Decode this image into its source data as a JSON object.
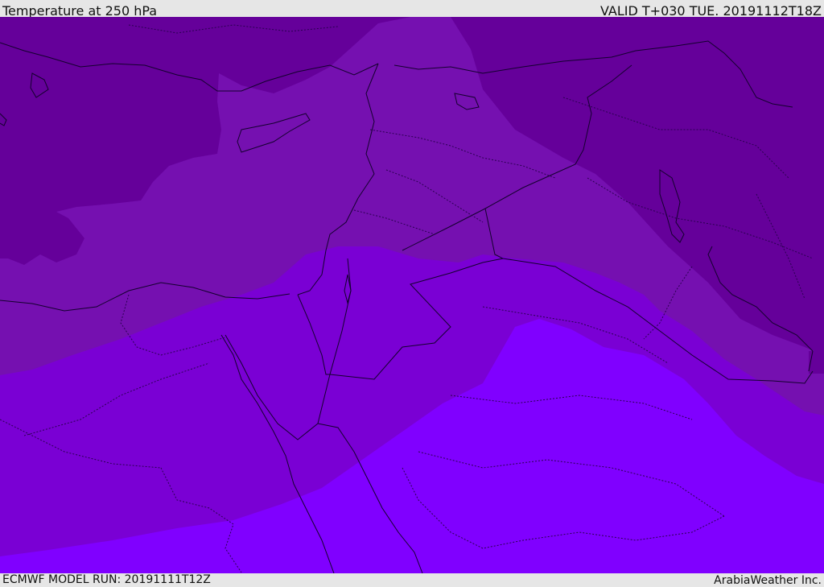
{
  "header": {
    "title": "Temperature at 250 hPa",
    "valid": "VALID T+030 TUE. 20191112T18Z"
  },
  "footer": {
    "model_run": "ECMWF MODEL RUN: 20191111T12Z",
    "credit": "ArabiaWeather Inc."
  },
  "colors": {
    "background": "#e6e6e6",
    "band_coldest": "#65009a",
    "band_cold": "#7510b0",
    "band_mid": "#7a00d4",
    "band_warm": "#8000ff",
    "coastline": "#14002e",
    "border_dotted": "#2a0050"
  }
}
